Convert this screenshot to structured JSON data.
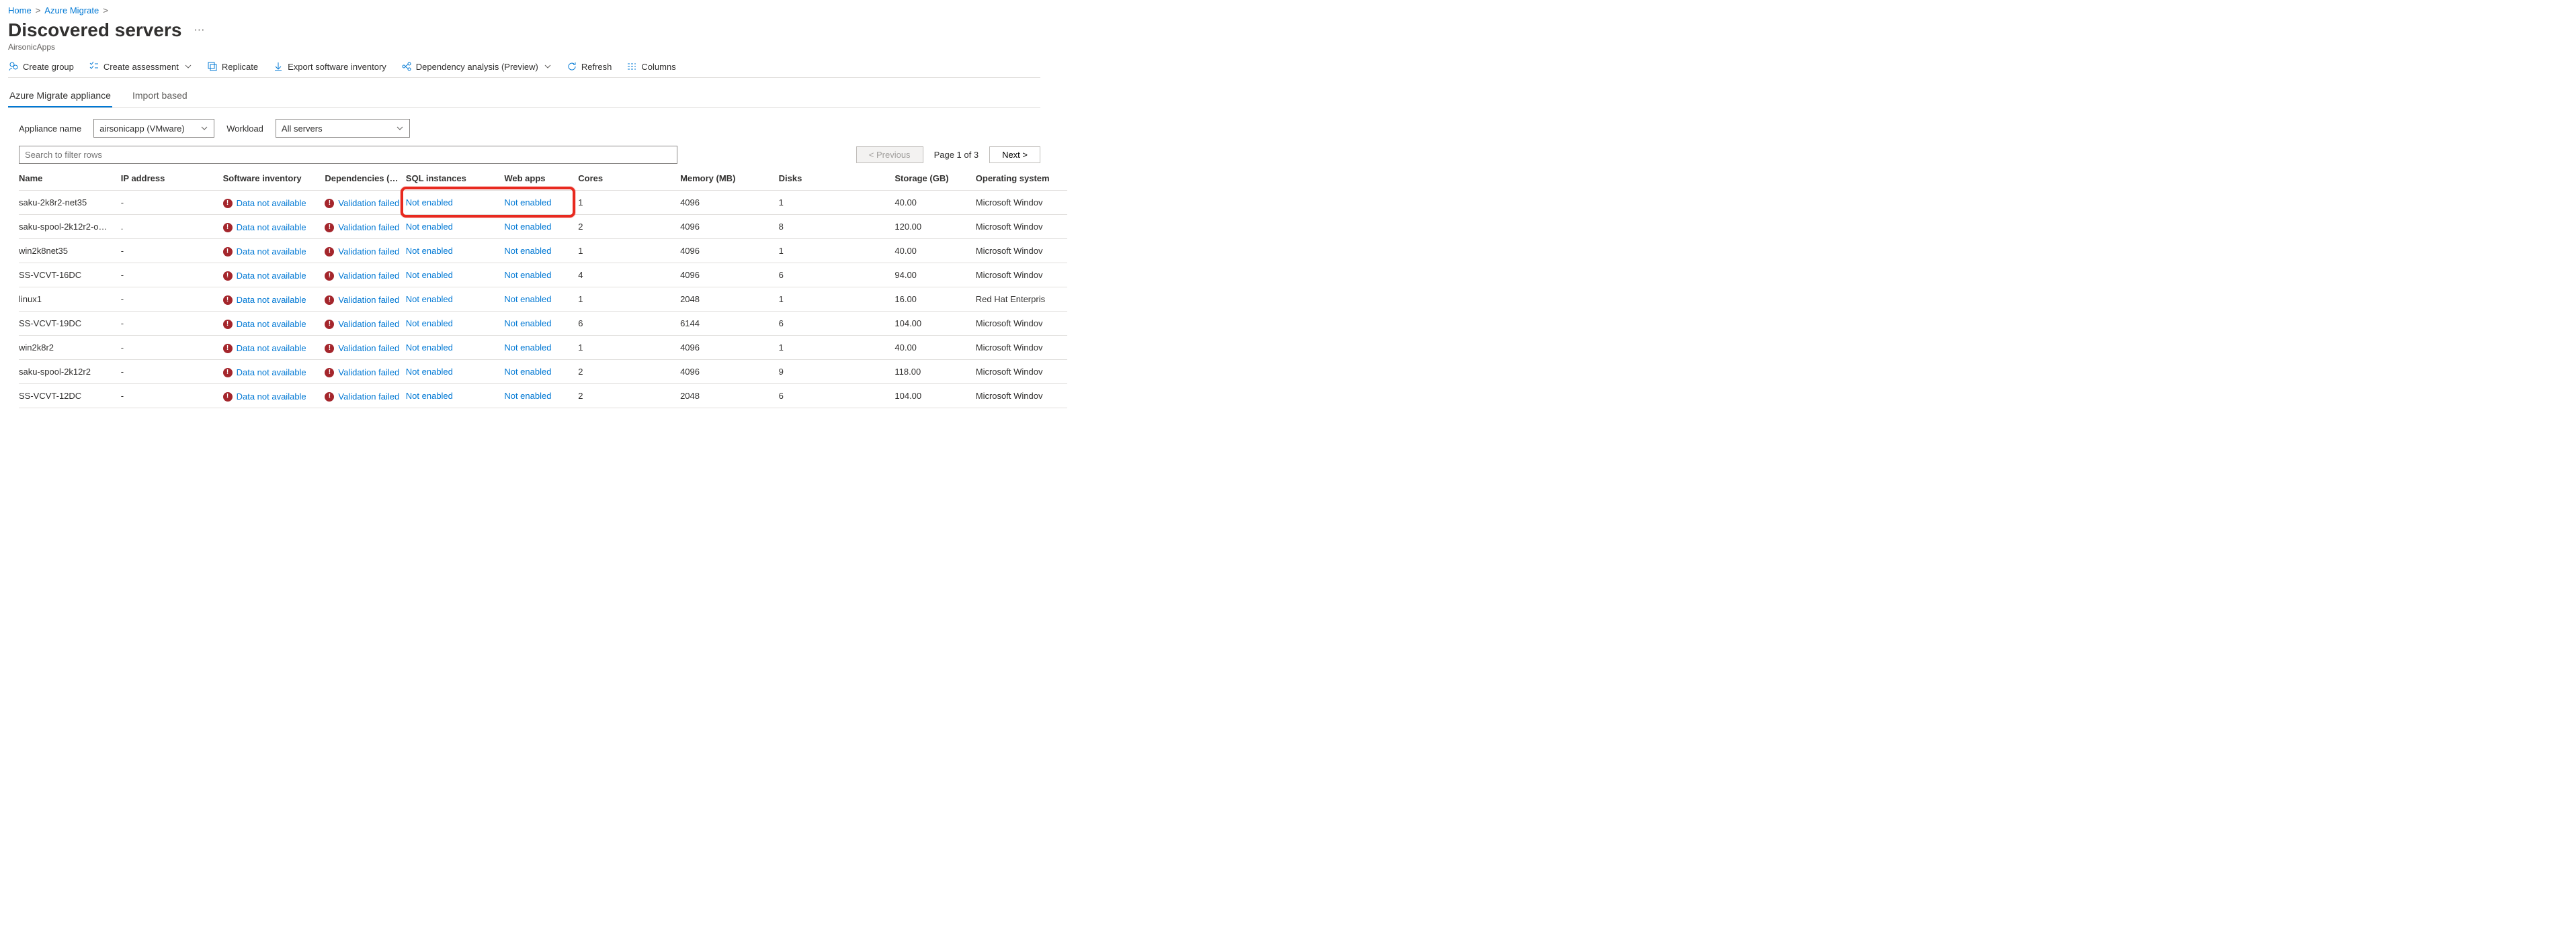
{
  "breadcrumb": {
    "home": "Home",
    "azure_migrate": "Azure Migrate",
    "sep": ">"
  },
  "page": {
    "title": "Discovered servers",
    "subtitle": "AirsonicApps"
  },
  "toolbar": {
    "create_group": "Create group",
    "create_assessment": "Create assessment",
    "replicate": "Replicate",
    "export_inventory": "Export software inventory",
    "dependency": "Dependency analysis (Preview)",
    "refresh": "Refresh",
    "columns": "Columns"
  },
  "tabs": {
    "appliance": "Azure Migrate appliance",
    "import": "Import based"
  },
  "filters": {
    "appliance_label": "Appliance name",
    "appliance_value": "airsonicapp (VMware)",
    "workload_label": "Workload",
    "workload_value": "All servers"
  },
  "search": {
    "placeholder": "Search to filter rows"
  },
  "pager": {
    "prev": "<  Previous",
    "info": "Page 1 of 3",
    "next": "Next  >"
  },
  "columns": {
    "name": "Name",
    "ip": "IP address",
    "software": "Software inventory",
    "deps": "Dependencies (Age…",
    "sql": "SQL instances",
    "web": "Web apps",
    "cores": "Cores",
    "memory": "Memory (MB)",
    "disks": "Disks",
    "storage": "Storage (GB)",
    "os": "Operating system"
  },
  "status": {
    "data_na": "Data not available",
    "validation_failed": "Validation failed",
    "not_enabled": "Not enabled"
  },
  "rows": [
    {
      "name": "saku-2k8r2-net35",
      "ip": "-",
      "cores": "1",
      "memory": "4096",
      "disks": "1",
      "storage": "40.00",
      "os": "Microsoft Windov"
    },
    {
      "name": "saku-spool-2k12r2-o…",
      "ip": ".",
      "cores": "2",
      "memory": "4096",
      "disks": "8",
      "storage": "120.00",
      "os": "Microsoft Windov"
    },
    {
      "name": "win2k8net35",
      "ip": "-",
      "cores": "1",
      "memory": "4096",
      "disks": "1",
      "storage": "40.00",
      "os": "Microsoft Windov"
    },
    {
      "name": "SS-VCVT-16DC",
      "ip": "-",
      "cores": "4",
      "memory": "4096",
      "disks": "6",
      "storage": "94.00",
      "os": "Microsoft Windov"
    },
    {
      "name": "linux1",
      "ip": "-",
      "cores": "1",
      "memory": "2048",
      "disks": "1",
      "storage": "16.00",
      "os": "Red Hat Enterpris"
    },
    {
      "name": "SS-VCVT-19DC",
      "ip": "-",
      "cores": "6",
      "memory": "6144",
      "disks": "6",
      "storage": "104.00",
      "os": "Microsoft Windov"
    },
    {
      "name": "win2k8r2",
      "ip": "-",
      "cores": "1",
      "memory": "4096",
      "disks": "1",
      "storage": "40.00",
      "os": "Microsoft Windov"
    },
    {
      "name": "saku-spool-2k12r2",
      "ip": "-",
      "cores": "2",
      "memory": "4096",
      "disks": "9",
      "storage": "118.00",
      "os": "Microsoft Windov"
    },
    {
      "name": "SS-VCVT-12DC",
      "ip": "-",
      "cores": "2",
      "memory": "2048",
      "disks": "6",
      "storage": "104.00",
      "os": "Microsoft Windov"
    }
  ]
}
